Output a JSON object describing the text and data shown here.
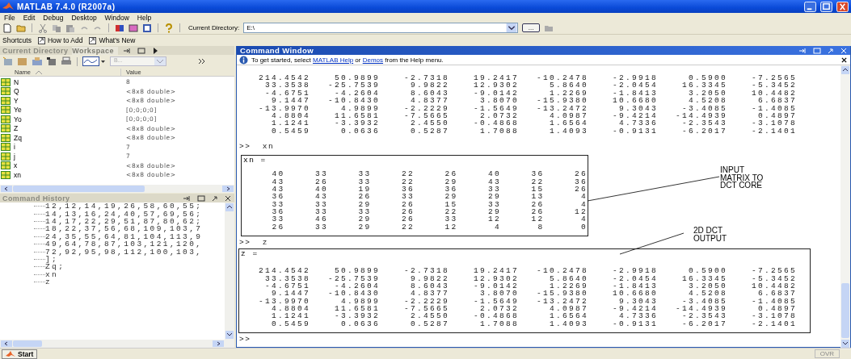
{
  "window": {
    "title": "MATLAB 7.4.0 (R2007a)"
  },
  "menu": [
    "File",
    "Edit",
    "Debug",
    "Desktop",
    "Window",
    "Help"
  ],
  "toolbar": {
    "directory_label": "Current Directory:",
    "directory": "E:\\",
    "browse": "..."
  },
  "shortcuts": {
    "label": "Shortcuts",
    "items": [
      "How to Add",
      "What's New"
    ]
  },
  "workspace": {
    "tabs": [
      {
        "label": "Current Directory",
        "selected": false
      },
      {
        "label": "Workspace",
        "selected": true
      }
    ],
    "stack": "B...",
    "columns": [
      "Name",
      "Value"
    ],
    "variables": [
      {
        "name": "N",
        "value": "8"
      },
      {
        "name": "Q",
        "value": "<8x8 double>"
      },
      {
        "name": "Y",
        "value": "<8x8 double>"
      },
      {
        "name": "Ye",
        "value": "[0;0;0;0]"
      },
      {
        "name": "Yo",
        "value": "[0;0;0;0]"
      },
      {
        "name": "Z",
        "value": "<8x8 double>"
      },
      {
        "name": "Zq",
        "value": "<8x8 double>"
      },
      {
        "name": "i",
        "value": "7"
      },
      {
        "name": "j",
        "value": "7"
      },
      {
        "name": "x",
        "value": "<8x8 double>"
      },
      {
        "name": "xn",
        "value": "<8x8 double>"
      }
    ]
  },
  "command_history": {
    "title": "Command History",
    "lines": [
      "12,12,14,19,26,58,60,55;",
      "14,13,16,24,40,57,69,56;",
      "14,17,22,29,51,87,80,62;",
      "18,22,37,56,68,109,103,7",
      "24,35,55,64,81,104,113,9",
      "49,64,78,87,103,121,120,",
      "72,92,95,98,112,100,103,",
      "];",
      "Zq;",
      "xn",
      "z"
    ]
  },
  "command_window": {
    "title": "Command Window",
    "info": {
      "before": "To get started, select ",
      "link_1": "MATLAB Help",
      "middle": " or ",
      "link_2": "Demos",
      "after": " from the Help menu."
    },
    "output": [
      {
        "kind": "matrix",
        "rows": [
          [
            "214.4542",
            "50.9899",
            "-2.7318",
            "19.2417",
            "-10.2478",
            "-2.9918",
            "0.5900",
            "-7.2565"
          ],
          [
            "33.3538",
            "-25.7539",
            "9.9822",
            "12.9302",
            "5.8640",
            "-2.0454",
            "16.3345",
            "-5.3452"
          ],
          [
            "-4.6751",
            "-4.2604",
            "8.6043",
            "-9.0142",
            "1.2269",
            "-1.8413",
            "3.2050",
            "10.4482"
          ],
          [
            "9.1447",
            "-10.8430",
            "4.8377",
            "3.8070",
            "-15.9380",
            "10.6680",
            "4.5208",
            "6.6837"
          ],
          [
            "-13.9970",
            "4.9899",
            "-2.2229",
            "-1.5649",
            "-13.2472",
            "9.3043",
            "-3.4085",
            "-1.4085"
          ],
          [
            "4.8804",
            "11.6581",
            "-7.5665",
            "2.0732",
            "4.0987",
            "-9.4214",
            "-14.4939",
            "0.4897"
          ],
          [
            "1.1241",
            "-3.3932",
            "2.4550",
            "-0.4868",
            "1.6564",
            "4.7336",
            "-2.3543",
            "-3.1078"
          ],
          [
            "0.5459",
            "0.0636",
            "0.5287",
            "1.7088",
            "1.4093",
            "-0.9131",
            "-6.2017",
            "-2.1401"
          ]
        ]
      },
      {
        "kind": "prompt",
        "text": ">>  xn"
      },
      {
        "kind": "boxed_matrix",
        "label": "xn =",
        "rows": [
          [
            "40",
            "33",
            "33",
            "22",
            "26",
            "40",
            "36",
            "26"
          ],
          [
            "43",
            "26",
            "33",
            "22",
            "29",
            "43",
            "22",
            "36"
          ],
          [
            "43",
            "40",
            "19",
            "36",
            "36",
            "33",
            "15",
            "26"
          ],
          [
            "36",
            "43",
            "26",
            "33",
            "29",
            "29",
            "13",
            "4"
          ],
          [
            "33",
            "33",
            "29",
            "26",
            "15",
            "33",
            "26",
            "4"
          ],
          [
            "36",
            "33",
            "33",
            "26",
            "22",
            "29",
            "26",
            "12"
          ],
          [
            "33",
            "46",
            "29",
            "26",
            "33",
            "12",
            "12",
            "4"
          ],
          [
            "26",
            "33",
            "29",
            "22",
            "12",
            "4",
            "8",
            "0"
          ]
        ]
      },
      {
        "kind": "prompt",
        "text": ">>  z"
      },
      {
        "kind": "boxed_matrix",
        "label": "z =",
        "rows": [
          [
            "214.4542",
            "50.9899",
            "-2.7318",
            "19.2417",
            "-10.2478",
            "-2.9918",
            "0.5900",
            "-7.2565"
          ],
          [
            "33.3538",
            "-25.7539",
            "9.9822",
            "12.9302",
            "5.8640",
            "-2.0454",
            "16.3345",
            "-5.3452"
          ],
          [
            "-4.6751",
            "-4.2604",
            "8.6043",
            "-9.0142",
            "1.2269",
            "-1.8413",
            "3.2050",
            "10.4482"
          ],
          [
            "9.1447",
            "-10.8430",
            "4.8377",
            "3.8070",
            "-15.9380",
            "10.6680",
            "4.5208",
            "6.6837"
          ],
          [
            "-13.9970",
            "4.9899",
            "-2.2229",
            "-1.5649",
            "-13.2472",
            "9.3043",
            "-3.4085",
            "-1.4085"
          ],
          [
            "4.8804",
            "11.6581",
            "-7.5665",
            "2.0732",
            "4.0987",
            "-9.4214",
            "-14.4939",
            "0.4897"
          ],
          [
            "1.1241",
            "-3.3932",
            "2.4550",
            "-0.4868",
            "1.6564",
            "4.7336",
            "-2.3543",
            "-3.1078"
          ],
          [
            "0.5459",
            "0.0636",
            "0.5287",
            "1.7088",
            "1.4093",
            "-0.9131",
            "-6.2017",
            "-2.1401"
          ]
        ]
      },
      {
        "kind": "prompt",
        "text": ">>"
      }
    ],
    "annotations": [
      {
        "lines": [
          "INPUT",
          "MATRIX TO",
          "DCT CORE"
        ]
      },
      {
        "lines": [
          "2D DCT",
          "OUTPUT"
        ]
      }
    ]
  },
  "status_bar": {
    "start": "Start",
    "mode": "OVR"
  }
}
